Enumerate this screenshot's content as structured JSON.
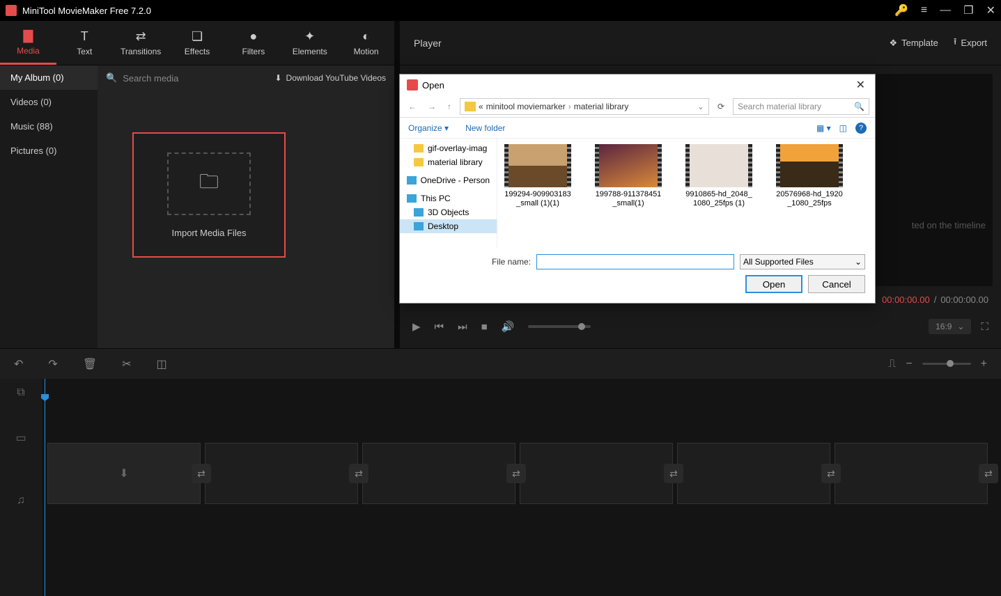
{
  "titlebar": {
    "title": "MiniTool MovieMaker Free 7.2.0"
  },
  "tabs": {
    "media": "Media",
    "text": "Text",
    "transitions": "Transitions",
    "effects": "Effects",
    "filters": "Filters",
    "elements": "Elements",
    "motion": "Motion"
  },
  "sidebar": {
    "album": "My Album (0)",
    "videos": "Videos (0)",
    "music": "Music (88)",
    "pictures": "Pictures (0)"
  },
  "media": {
    "search_placeholder": "Search media",
    "yt": "Download YouTube Videos",
    "import": "Import Media Files"
  },
  "player": {
    "title": "Player",
    "template": "Template",
    "export": "Export",
    "hint": "ted on the timeline",
    "time_current": "00:00:00.00",
    "time_total": "00:00:00.00",
    "ratio": "16:9"
  },
  "file_dialog": {
    "title": "Open",
    "bc_chev": "«",
    "bc1": "minitool moviemarker",
    "bc2": "material library",
    "search_placeholder": "Search material library",
    "organize": "Organize",
    "newfolder": "New folder",
    "tree": {
      "gif": "gif-overlay-imag",
      "material": "material library",
      "onedrive": "OneDrive - Person",
      "thispc": "This PC",
      "objects3d": "3D Objects",
      "desktop": "Desktop"
    },
    "files": {
      "f1": "199294-909903183_small (1)(1)",
      "f2": "199788-911378451_small(1)",
      "f3": "9910865-hd_2048_1080_25fps (1)",
      "f4": "20576968-hd_1920_1080_25fps"
    },
    "filename_label": "File name:",
    "filter": "All Supported Files",
    "open": "Open",
    "cancel": "Cancel"
  }
}
